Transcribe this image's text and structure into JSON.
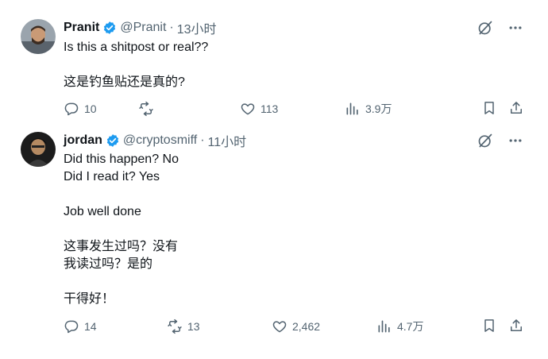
{
  "tweets": [
    {
      "name": "Pranit",
      "handle": "@Pranit",
      "separator": "·",
      "time": "13小时",
      "lines": [
        "Is this a shitpost or real??",
        "",
        "这是钓鱼贴还是真的?"
      ],
      "replies": "10",
      "reposts": "",
      "likes": "113",
      "views": "3.9万"
    },
    {
      "name": "jordan",
      "handle": "@cryptosmiff",
      "separator": "·",
      "time": "11小时",
      "lines": [
        "Did this happen? No",
        "Did I read it? Yes",
        "",
        "Job well done",
        "",
        "这事发生过吗？没有",
        "我读过吗？是的",
        "",
        "干得好！"
      ],
      "replies": "14",
      "reposts": "13",
      "likes": "2,462",
      "views": "4.7万"
    }
  ],
  "colors": {
    "text": "#0f1419",
    "secondary": "#536471",
    "verified": "#1d9bf0"
  },
  "icons": [
    "verified-badge-icon",
    "grok-icon",
    "more-icon",
    "reply-icon",
    "repost-icon",
    "like-icon",
    "views-icon",
    "bookmark-icon",
    "share-icon"
  ]
}
